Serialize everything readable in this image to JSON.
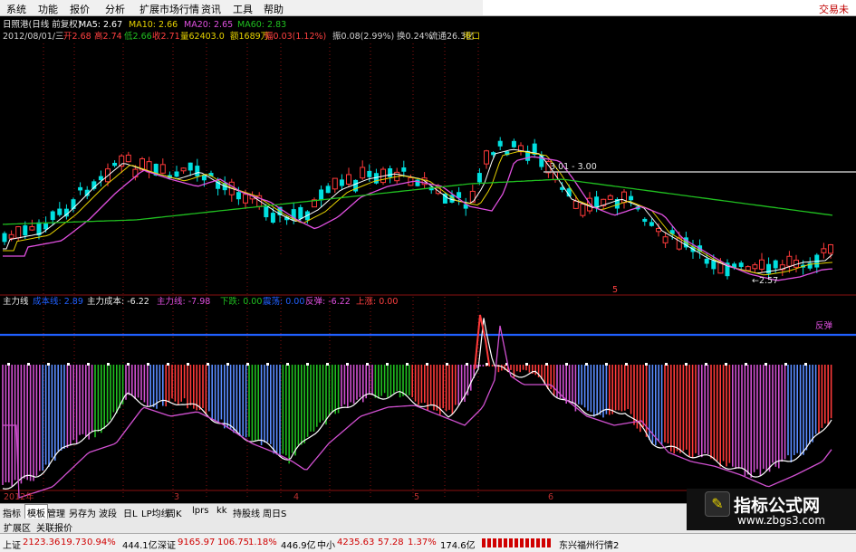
{
  "menu": {
    "items": [
      "系统",
      "功能",
      "报价",
      "分析",
      "扩展市场行情",
      "资讯",
      "工具",
      "帮助"
    ],
    "right_text": "交易未"
  },
  "header": {
    "stock_name": "日照港(日线 前复权)",
    "ma5": "MA5: 2.67",
    "ma10": "MA10: 2.66",
    "ma20": "MA20: 2.65",
    "ma60": "MA60: 2.83",
    "line2": {
      "date": "2012/08/01/三",
      "open": "开2.68",
      "high": "高2.74",
      "low": "低2.66",
      "close": "收2.71",
      "volume": "量62403.0",
      "amount": "额1689万",
      "change": "幅0.03(1.12%)",
      "amplitude": "振0.08(2.99%)",
      "turnover": "换0.24%",
      "float_cap": "流通26.3亿",
      "region": "港口"
    },
    "range_label": "3.01 - 3.00",
    "low_label": "←2.57",
    "marker_5": "5"
  },
  "indicator": {
    "title": "主力线",
    "cost_line": "成本线: 2.89",
    "main_cost": "主力成本: -6.22",
    "main_line": "主力线: -7.98",
    "down": "下跌: 0.00",
    "shock": "震荡: 0.00",
    "rebound": "反弹: -6.22",
    "up": "上涨: 0.00",
    "rebound_label": "反弹"
  },
  "axis": {
    "year_label": "2012年",
    "month_labels": [
      "3",
      "4",
      "5",
      "6"
    ]
  },
  "tabs_row1": [
    "指标",
    "模板",
    "管理",
    "另存为",
    "波段",
    "日L",
    "LP均线",
    "周K",
    "lprs",
    "kk",
    "持股线",
    "周日S"
  ],
  "tabs_row1_active": "模板",
  "tabs_row2": [
    "扩展区",
    "关联报价"
  ],
  "status": {
    "sh_label": "上证",
    "sh_value": "2123.36",
    "sh_change": "19.73",
    "sh_pct": "0.94%",
    "sh_amount": "444.1亿",
    "sz_label": "深证",
    "sz_value": "9165.97",
    "sz_change": "106.75",
    "sz_pct": "1.18%",
    "sz_amount": "446.9亿",
    "zx_label": "中小",
    "zx_value": "4235.63",
    "zx_change": "57.28",
    "zx_pct": "1.37%",
    "zx_amount": "174.6亿",
    "feed": "东兴福州行情2"
  },
  "watermark": {
    "title": "指标公式网",
    "url": "www.zbgs3.com"
  },
  "colors": {
    "up": "#ff3a3a",
    "down": "#00e0e0",
    "ma5": "#ffffff",
    "ma10": "#e6d200",
    "ma20": "#e050e0",
    "ma60": "#20c020",
    "cost_line": "#2060ff"
  }
}
